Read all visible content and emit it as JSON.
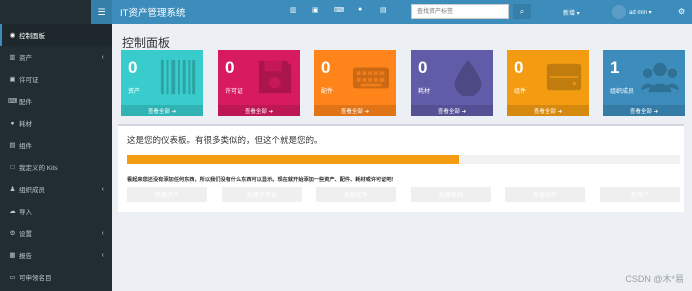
{
  "app": {
    "title": "IT资产管理系统"
  },
  "sidebar": {
    "toggle_icon": "hamburger-icon",
    "items": [
      {
        "label": "控制面板",
        "icon": "dashboard-icon",
        "active": true
      },
      {
        "label": "资产",
        "icon": "barcode-icon",
        "has_children": true
      },
      {
        "label": "许可证",
        "icon": "save-icon"
      },
      {
        "label": "配件",
        "icon": "keyboard-icon"
      },
      {
        "label": "耗材",
        "icon": "tint-icon"
      },
      {
        "label": "组件",
        "icon": "hdd-icon"
      },
      {
        "label": "我定义的 Kits",
        "icon": "box-icon"
      },
      {
        "label": "组织成员",
        "icon": "users-icon",
        "has_children": true
      },
      {
        "label": "导入",
        "icon": "cloud-upload-icon"
      },
      {
        "label": "设置",
        "icon": "gear-icon",
        "has_children": true
      },
      {
        "label": "报告",
        "icon": "chart-icon",
        "has_children": true
      },
      {
        "label": "可申领名目",
        "icon": "laptop-icon"
      }
    ]
  },
  "header": {
    "search": {
      "placeholder": "查找资产标签",
      "value": ""
    },
    "new_menu": "新增 ▾",
    "user_menu": "ad min ▾"
  },
  "page_title": "控制面板",
  "tiles": [
    {
      "count": "0",
      "label": "资产",
      "footer": "查看全部 ➜",
      "color": "#39cccc",
      "icon": "barcode-icon"
    },
    {
      "count": "0",
      "label": "许可证",
      "footer": "查看全部 ➜",
      "color": "#d81b60",
      "icon": "save-icon"
    },
    {
      "count": "0",
      "label": "配件",
      "footer": "查看全部 ➜",
      "color": "#ff851b",
      "icon": "keyboard-icon"
    },
    {
      "count": "0",
      "label": "耗材",
      "footer": "查看全部 ➜",
      "color": "#605ca8",
      "icon": "tint-icon"
    },
    {
      "count": "0",
      "label": "组件",
      "footer": "查看全部 ➜",
      "color": "#f39c12",
      "icon": "hdd-icon"
    },
    {
      "count": "1",
      "label": "组织成员",
      "footer": "查看全部 ➜",
      "color": "#3c8dbc",
      "icon": "users-icon"
    }
  ],
  "panel": {
    "text": "这是您的仪表板。有很多类似的，但这个就是您的。",
    "progress": 0.6,
    "warning": "看起来您还没有添加任何东西，所以我们没有什么东西可以显示。现在就开始添加一些资产、配件、耗材或许可证吧!",
    "buttons": [
      {
        "label": "新建资产",
        "color": "#39cccc"
      },
      {
        "label": "新建许可证",
        "color": "#d81b60"
      },
      {
        "label": "新建配件",
        "color": "#ff851b"
      },
      {
        "label": "新建耗材",
        "color": "#605ca8"
      },
      {
        "label": "新建组件",
        "color": "#f39c12"
      },
      {
        "label": "新用户",
        "color": "#3c8dbc"
      }
    ]
  },
  "watermark": "CSDN @木*易"
}
